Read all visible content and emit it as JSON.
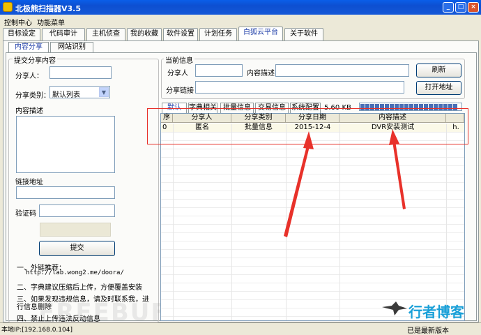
{
  "window": {
    "title": "北极熊扫描器V3.5"
  },
  "menu": [
    "控制中心",
    "功能菜单"
  ],
  "main_tabs": [
    "目标设定",
    "代码审计",
    "主机侦查",
    "我的收藏",
    "软件设置",
    "计划任务",
    "白狐云平台",
    "关于软件"
  ],
  "sub_tabs": [
    "内容分享",
    "网站识别"
  ],
  "submit": {
    "group_title": "提交分享内容",
    "sharer_label": "分享人：",
    "sharer_value": "",
    "category_label": "分享类别：",
    "category_value": "默认列表",
    "desc_label": "内容描述",
    "desc_value": "",
    "link_label": "链接地址",
    "link_value": "",
    "captcha_label": "验证码",
    "captcha_value": "",
    "submit_button": "提交",
    "notes": [
      "一、外链推荐：",
      "http://lab.wong2.me/doora/",
      "二、字典建议压缩后上传，方便覆盖安装",
      "三、如果发现违规信息，请及时联系我，进",
      "行信息删除",
      "四、禁止上传违法反动信息"
    ]
  },
  "current": {
    "group_title": "当前信息",
    "sharer_label": "分享人",
    "sharer_value": "",
    "desc_label": "内容描述",
    "desc_value": "",
    "link_label": "分享链接",
    "link_value": "",
    "refresh_button": "刷新",
    "open_button": "打开地址"
  },
  "list_tabs": [
    "默认",
    "字典相关",
    "批量信息",
    "交易信息",
    "系统配置"
  ],
  "size_text": "5.60 KB",
  "progress": 1.0,
  "table": {
    "columns": [
      "序",
      "分享人",
      "分享类别",
      "分享日期",
      "内容描述"
    ],
    "rows": [
      {
        "index": "0",
        "sharer": "匿名",
        "category": "批量信息",
        "date": "2015-12-4",
        "desc": "DVR安装测试",
        "extra": "h."
      }
    ]
  },
  "watermark": "FREEBUF",
  "logo_text": "行者博客",
  "status": {
    "ip": "本地IP:[192.168.0.104]",
    "version": "已是最新版本"
  },
  "colors": {
    "annotation_red": "#e8312a",
    "title_blue": "#0d4fd0",
    "accent_blue": "#1f3ea8"
  }
}
